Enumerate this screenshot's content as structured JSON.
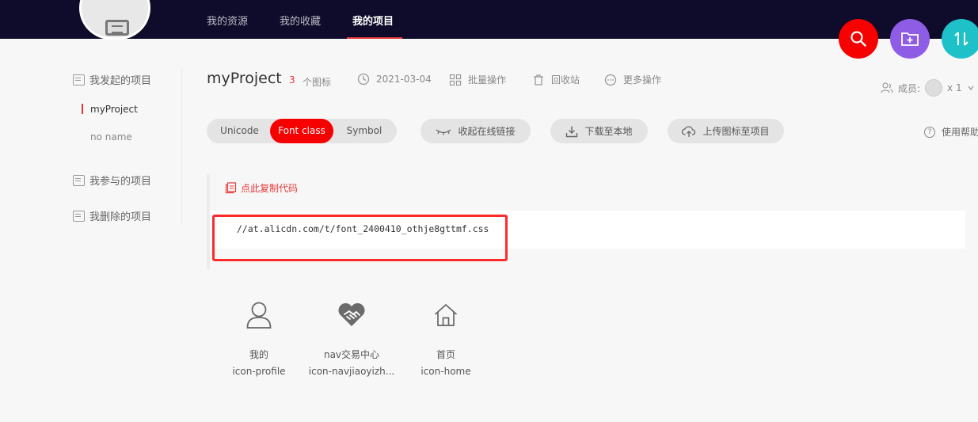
{
  "nav": {
    "items": [
      {
        "label": "我的资源"
      },
      {
        "label": "我的收藏"
      },
      {
        "label": "我的项目"
      }
    ]
  },
  "sidebar": {
    "groups": [
      {
        "label": "我发起的项目"
      },
      {
        "label": "我参与的项目"
      },
      {
        "label": "我删除的项目"
      }
    ],
    "projects": [
      {
        "label": "myProject"
      },
      {
        "label": "no name"
      }
    ]
  },
  "header": {
    "title": "myProject",
    "icon_count": "3",
    "icon_count_label": "个图标",
    "date": "2021-03-04",
    "batch": "批量操作",
    "trash": "回收站",
    "more": "更多操作",
    "members_label": "成员:",
    "members_count": "x 1"
  },
  "toolbar": {
    "tabs": [
      {
        "label": "Unicode"
      },
      {
        "label": "Font class"
      },
      {
        "label": "Symbol"
      }
    ],
    "active_tab": "Font class",
    "collapse_link": "收起在线链接",
    "download": "下载至本地",
    "upload": "上传图标至项目",
    "help": "使用帮助"
  },
  "code": {
    "copy_label": "点此复制代码",
    "url": "//at.alicdn.com/t/font_2400410_othje8gttmf.css"
  },
  "icons": [
    {
      "name": "我的",
      "class": "icon-profile",
      "icon": "profile-icon"
    },
    {
      "name": "nav交易中心",
      "class": "icon-navjiaoyizh...",
      "icon": "handshake-heart-icon"
    },
    {
      "name": "首页",
      "class": "icon-home",
      "icon": "home-icon"
    }
  ],
  "colors": {
    "accent": "#f60000",
    "topbar": "#0e0c2a",
    "fab_search": "#f60000",
    "fab_folder": "#8f5ce6",
    "fab_sort": "#1ec1c8"
  }
}
